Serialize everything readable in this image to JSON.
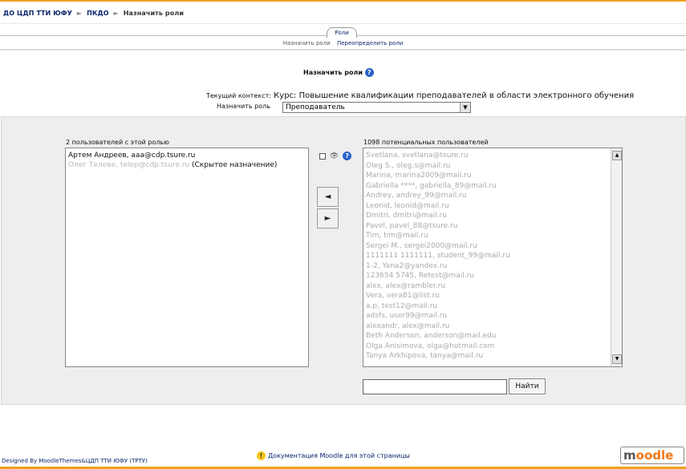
{
  "breadcrumb": {
    "home": "ДО ЦДП ТТИ ЮФУ",
    "sep1": "►",
    "course": "ПКДО",
    "sep2": "►",
    "current": "Назначить роли"
  },
  "tabs": {
    "active": "Роли",
    "sub1": "Назначить роли",
    "sub2": "Переопределить роли"
  },
  "page": {
    "title": "Назначить роли",
    "context_label": "Текущий контекст:",
    "context_value": "Курс: Повышение квалификации преподавателей в области электронного обучения",
    "assign_label": "Назначить роль",
    "role_selected": "Преподаватель"
  },
  "left": {
    "header": "2 пользователей с этой ролью",
    "items": [
      "Артем Андреев, aaa@cdp.tsure.ru",
      "Олег Телеве, telep@cdp.tsure.ru",
      "(Скрытое назначение)"
    ]
  },
  "right": {
    "header": "1098 потенциальных пользователей",
    "items": [
      "Svetlana, svetlana@tsure.ru",
      "Oleg S., oleg.s@mail.ru",
      "Marina, marina2009@mail.ru",
      "Gabriella ****, gabriella_89@mail.ru",
      "Andrey, andrey_99@mail.ru",
      "Leonid, leonid@mail.ru",
      "Dmitri, dmitri@mail.ru",
      "Pavel, pavel_88@tsure.ru",
      "Tim, tim@mail.ru",
      "Sergei M., sergei2000@mail.ru",
      "1111111 1111111, student_99@mail.ru",
      "1-2, Yana2@yandex.ru",
      "123654 5745, Retest@mail.ru",
      "alex, alex@rambler.ru",
      "Vera, vera81@list.ru",
      "a.p, test12@mail.ru",
      "adsfs, user99@mail.ru",
      "alexandr, alex@mail.ru",
      "Beth Anderson, anderson@mail.edu",
      "Olga Anisimova, olga@hotmail.com",
      "Tanya Arkhipova, tanya@mail.ru"
    ],
    "find_button": "Найти",
    "search_value": ""
  },
  "controls": {
    "add_arrow": "◄",
    "remove_arrow": "►",
    "eye": "👁",
    "help": "?"
  },
  "footer": {
    "designed": "Designed By MoodleThemes&ЦДП ТТИ ЮФУ (ТРТУ)",
    "doc_link": "Документация Moodle для этой страницы",
    "logo": "moodle"
  }
}
